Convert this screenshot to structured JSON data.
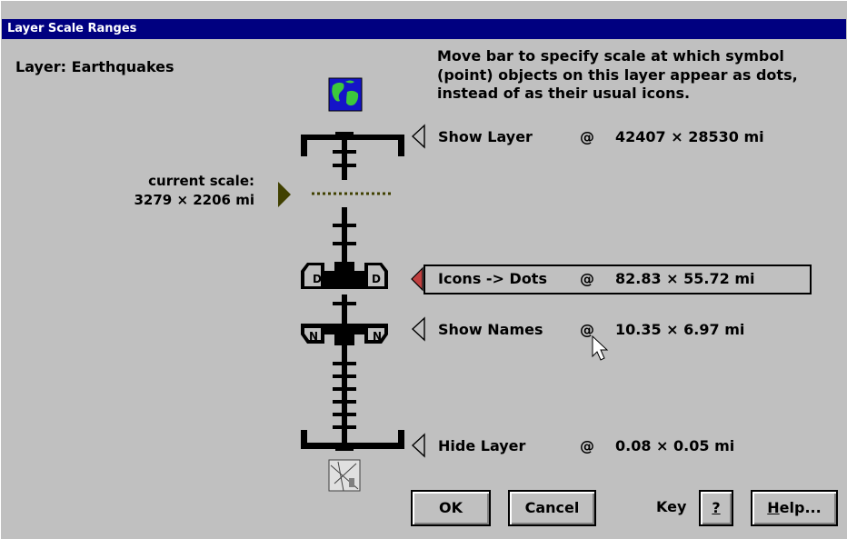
{
  "window": {
    "title": "Layer Scale Ranges"
  },
  "layer": {
    "label": "Layer: Earthquakes"
  },
  "instructions": "Move bar to specify scale at which symbol (point) objects on this layer appear as dots, instead of as their usual icons.",
  "current_scale": {
    "line1": "current scale:",
    "line2": "3279 × 2206 mi"
  },
  "rows": [
    {
      "label": "Show Layer",
      "at": "@",
      "value": "42407 × 28530 mi"
    },
    {
      "label": "Icons -> Dots",
      "at": "@",
      "value": "82.83 × 55.72 mi"
    },
    {
      "label": "Show Names",
      "at": "@",
      "value": "10.35 × 6.97 mi"
    },
    {
      "label": "Hide Layer",
      "at": "@",
      "value": "0.08 × 0.05 mi"
    }
  ],
  "buttons": {
    "ok": "OK",
    "cancel": "Cancel",
    "key_label": "Key",
    "question": "?",
    "help_first": "H",
    "help_rest": "elp..."
  },
  "markers": {
    "dots_letter": "D",
    "names_letter": "N"
  },
  "colors": {
    "title_bg": "#000080",
    "face": "#c0c0c0",
    "current_marker": "#404000",
    "active_pointer": "#c04040"
  }
}
